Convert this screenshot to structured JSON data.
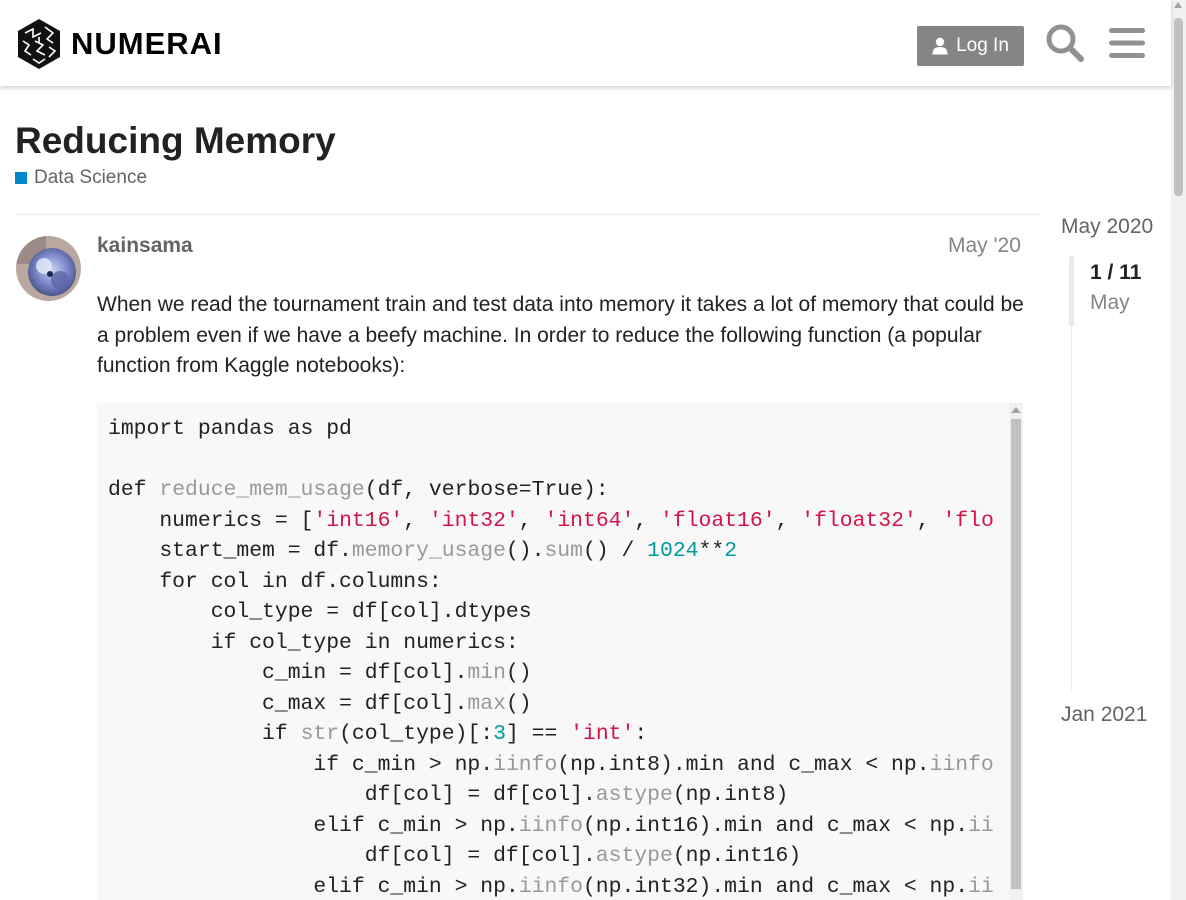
{
  "colors": {
    "accent_category": "#0088cc",
    "login_button_bg": "#858585",
    "code_string": "#d2144a",
    "code_number": "#009999",
    "code_function": "#999999"
  },
  "header": {
    "logo_text": "NUMERAI",
    "login_label": "Log In",
    "icons": [
      "logo-mark",
      "user-icon",
      "search-icon",
      "hamburger-menu-icon"
    ]
  },
  "topic": {
    "title": "Reducing Memory",
    "category": "Data Science"
  },
  "post": {
    "username": "kainsama",
    "date": "May '20",
    "body": "When we read the tournament train and test data into memory it takes a lot of memory that could be a problem even if we have a beefy machine. In order to reduce the following function (a popular function from Kaggle notebooks):",
    "code_lines": [
      [
        {
          "t": "import pandas as pd"
        }
      ],
      [
        {
          "t": ""
        }
      ],
      [
        {
          "t": "def "
        },
        {
          "t": "reduce_mem_usage",
          "c": "fn"
        },
        {
          "t": "(df, verbose=True):"
        }
      ],
      [
        {
          "t": "    numerics = ["
        },
        {
          "t": "'int16'",
          "c": "str"
        },
        {
          "t": ", "
        },
        {
          "t": "'int32'",
          "c": "str"
        },
        {
          "t": ", "
        },
        {
          "t": "'int64'",
          "c": "str"
        },
        {
          "t": ", "
        },
        {
          "t": "'float16'",
          "c": "str"
        },
        {
          "t": ", "
        },
        {
          "t": "'float32'",
          "c": "str"
        },
        {
          "t": ", "
        },
        {
          "t": "'flo",
          "c": "str"
        }
      ],
      [
        {
          "t": "    start_mem = df."
        },
        {
          "t": "memory_usage",
          "c": "fn"
        },
        {
          "t": "()."
        },
        {
          "t": "sum",
          "c": "fn"
        },
        {
          "t": "() / "
        },
        {
          "t": "1024",
          "c": "num"
        },
        {
          "t": "**"
        },
        {
          "t": "2",
          "c": "num"
        }
      ],
      [
        {
          "t": "    for col in df.columns:"
        }
      ],
      [
        {
          "t": "        col_type = df[col].dtypes"
        }
      ],
      [
        {
          "t": "        if col_type in numerics:"
        }
      ],
      [
        {
          "t": "            c_min = df[col]."
        },
        {
          "t": "min",
          "c": "fn"
        },
        {
          "t": "()"
        }
      ],
      [
        {
          "t": "            c_max = df[col]."
        },
        {
          "t": "max",
          "c": "fn"
        },
        {
          "t": "()"
        }
      ],
      [
        {
          "t": "            if "
        },
        {
          "t": "str",
          "c": "fn"
        },
        {
          "t": "(col_type)[:"
        },
        {
          "t": "3",
          "c": "num"
        },
        {
          "t": "] == "
        },
        {
          "t": "'int'",
          "c": "str"
        },
        {
          "t": ":"
        }
      ],
      [
        {
          "t": "                if c_min > np."
        },
        {
          "t": "iinfo",
          "c": "fn"
        },
        {
          "t": "(np.int8).min and c_max < np."
        },
        {
          "t": "iinfo",
          "c": "fn"
        }
      ],
      [
        {
          "t": "                    df[col] = df[col]."
        },
        {
          "t": "astype",
          "c": "fn"
        },
        {
          "t": "(np.int8)"
        }
      ],
      [
        {
          "t": "                elif c_min > np."
        },
        {
          "t": "iinfo",
          "c": "fn"
        },
        {
          "t": "(np.int16).min and c_max < np."
        },
        {
          "t": "ii",
          "c": "fn"
        }
      ],
      [
        {
          "t": "                    df[col] = df[col]."
        },
        {
          "t": "astype",
          "c": "fn"
        },
        {
          "t": "(np.int16)"
        }
      ],
      [
        {
          "t": "                elif c_min > np."
        },
        {
          "t": "iinfo",
          "c": "fn"
        },
        {
          "t": "(np.int32).min and c_max < np."
        },
        {
          "t": "ii",
          "c": "fn"
        }
      ]
    ]
  },
  "timeline": {
    "start_label": "May 2020",
    "position": "1 / 11",
    "position_date": "May",
    "end_label": "Jan 2021",
    "progress_fraction": 0.09
  }
}
